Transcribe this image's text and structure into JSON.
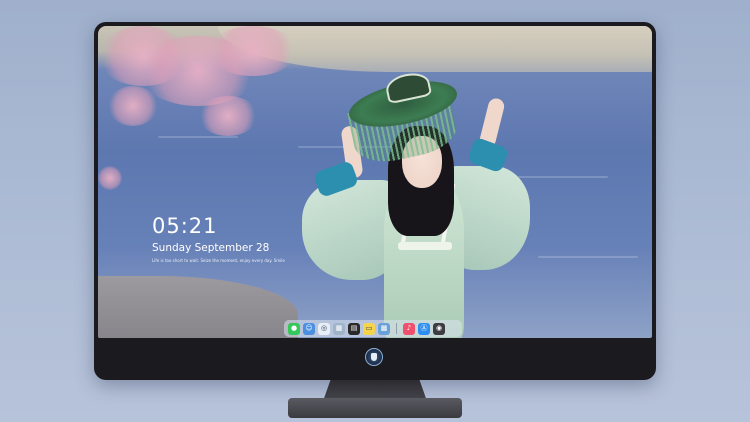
{
  "lock_screen": {
    "time": "05:21",
    "date": "Sunday September  28",
    "quote": "Life is too short to wait. Seize the moment, enjoy every day. Smile"
  },
  "dock": {
    "items": [
      {
        "name": "messages-icon",
        "color": "#34c759",
        "glyph": "●"
      },
      {
        "name": "finder-icon",
        "color": "#4a8fe0",
        "glyph": "☺"
      },
      {
        "name": "safari-icon",
        "color": "#e8eef6",
        "glyph": "◎"
      },
      {
        "name": "preview-icon",
        "color": "#9fb4c8",
        "glyph": "▦"
      },
      {
        "name": "claquette-icon",
        "color": "#2a2a2a",
        "glyph": "▤"
      },
      {
        "name": "notes-icon",
        "color": "#f5d34a",
        "glyph": "▭"
      },
      {
        "name": "photos-icon",
        "color": "#6aa0d8",
        "glyph": "▩"
      },
      {
        "name": "music-icon",
        "color": "#f0506e",
        "glyph": "♪"
      },
      {
        "name": "app-store-icon",
        "color": "#2e8ef0",
        "glyph": "Ⓐ"
      },
      {
        "name": "screenshot-icon",
        "color": "#3c3c42",
        "glyph": "◉"
      }
    ]
  }
}
